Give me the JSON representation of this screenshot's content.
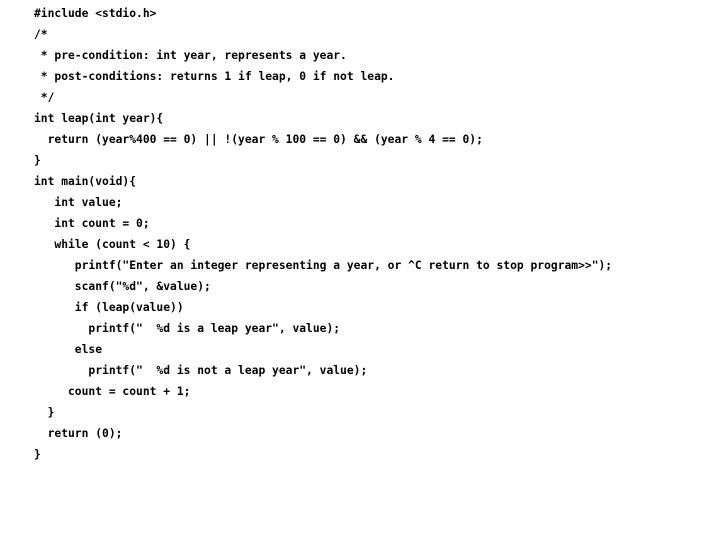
{
  "document": {
    "kind": "source-code-listing",
    "language": "C",
    "background_color": "#ffffff",
    "text_color": "#000000",
    "font_weight": "bold",
    "font_style": "monospace"
  },
  "code": {
    "lines": [
      "#include <stdio.h>",
      "/*",
      " * pre-condition: int year, represents a year.",
      " * post-conditions: returns 1 if leap, 0 if not leap.",
      " */",
      "int leap(int year){",
      "  return (year%400 == 0) || !(year % 100 == 0) && (year % 4 == 0);",
      "}",
      "int main(void){",
      "   int value;",
      "   int count = 0;",
      "   while (count < 10) {",
      "      printf(\"Enter an integer representing a year, or ^C return to stop program>>\");",
      "      scanf(\"%d\", &value);",
      "      if (leap(value))",
      "        printf(\"  %d is a leap year\", value);",
      "      else",
      "        printf(\"  %d is not a leap year\", value);",
      "     count = count + 1;",
      "  }",
      "  return (0);",
      "}"
    ]
  }
}
